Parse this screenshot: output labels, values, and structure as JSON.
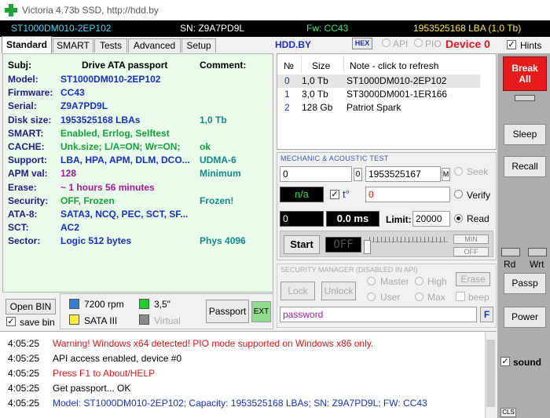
{
  "window": {
    "title": "Victoria 4.73b SSD, http://hdd.by"
  },
  "infobar": {
    "model": "ST1000DM010-2EP102",
    "sn": "SN: Z9A7PD9L",
    "fw": "Fw: CC43",
    "lba": "1953525168 LBA (1,0 Tb)"
  },
  "tabs": [
    "Standard",
    "SMART",
    "Tests",
    "Advanced",
    "Setup"
  ],
  "toolbar": {
    "site": "HDD.BY",
    "hex": "HEX",
    "api": "API",
    "pio": "PIO",
    "device": "Device 0",
    "hints": "Hints"
  },
  "passport": {
    "subj_header": "Subj:",
    "title_header": "Drive ATA passport",
    "comment_header": "Comment:",
    "rows": [
      {
        "label": "Model:",
        "value": "ST1000DM010-2EP102",
        "comment": ""
      },
      {
        "label": "Firmware:",
        "value": "CC43",
        "comment": ""
      },
      {
        "label": "Serial:",
        "value": "Z9A7PD9L",
        "comment": ""
      },
      {
        "label": "Disk size:",
        "value": "1953525168 LBAs",
        "comment": "1,0 Tb"
      },
      {
        "label": "SMART:",
        "value": "Enabled, Errlog, Selftest",
        "comment": ""
      },
      {
        "label": "CACHE:",
        "value": "Unk.size; L/A=ON; Wr=ON;",
        "comment": "ok"
      },
      {
        "label": "Support:",
        "value": "LBA, HPA, APM, DLM, DCO...",
        "comment": "UDMA-6"
      },
      {
        "label": "APM val:",
        "value": "128",
        "comment": "Minimum"
      },
      {
        "label": "Erase:",
        "value": "~ 1 hours 56 minutes",
        "comment": ""
      },
      {
        "label": "Security:",
        "value": "OFF, Frozen",
        "comment": "Frozen!"
      },
      {
        "label": "ATA-8:",
        "value": "SATA3, NCQ, PEC, SCT, SF...",
        "comment": ""
      },
      {
        "label": "SCT:",
        "value": "AC2",
        "comment": ""
      },
      {
        "label": "Sector:",
        "value": "Logic 512 bytes",
        "comment": "Phys 4096"
      }
    ]
  },
  "bottom_controls": {
    "open_bin": "Open BIN",
    "save_bin": "save bin",
    "rpm": "7200 rpm",
    "form_factor": "3,5\"",
    "sata": "SATA III",
    "virtual": "Virtual",
    "passport_btn": "Passport",
    "ext_btn": "EXT",
    "colors": {
      "rpm": "#2f7fd8",
      "form": "#22cc33",
      "sata": "#ffee33",
      "virtual": "#8a8a8a"
    }
  },
  "device_list": {
    "headers": [
      "№",
      "Size",
      "Note - click to refresh"
    ],
    "rows": [
      {
        "num": "0",
        "size": "1,0 Tb",
        "note": "ST1000DM010-2EP102"
      },
      {
        "num": "1",
        "size": "3,0 Tb",
        "note": "ST3000DM001-1ER166"
      },
      {
        "num": "2",
        "size": "128 Gb",
        "note": "Patriot Spark"
      }
    ]
  },
  "mechanic": {
    "title": "MECHANIC  &  ACOUSTIC TEST",
    "start_lba": "0",
    "zero_btn": "0",
    "end_lba": "1953525167",
    "m_btn": "M",
    "seek": "Seek",
    "na": "n/a",
    "temp_label": "t°",
    "verify_value": "0",
    "verify": "Verify",
    "counter": "0",
    "speed": "0.0 ms",
    "limit_label": "Limit:",
    "limit_value": "20000",
    "read": "Read",
    "start_btn": "Start",
    "off_indicator": "OFF",
    "min_btn": "MIN",
    "off_btn": "OFF"
  },
  "security": {
    "title": "SECURITY MANAGER (DISABLED IN API)",
    "lock": "Lock",
    "unlock": "Unlock",
    "master": "Master",
    "high": "High",
    "user": "User",
    "max": "Max",
    "erase": "Erase",
    "beep": "beep",
    "password": "password",
    "f_btn": "F"
  },
  "right_panel": {
    "break_all": [
      "Break",
      "All"
    ],
    "sleep": "Sleep",
    "recall": "Recall",
    "rd": "Rd",
    "wrt": "Wrt",
    "passp": "Passp",
    "power": "Power",
    "sound": "sound",
    "cls": "CLS"
  },
  "log": [
    {
      "time": "4:05:25",
      "text": "Warning! Windows x64 detected! PIO mode supported on Windows x86 only.",
      "color": "#e0141a"
    },
    {
      "time": "4:05:25",
      "text": "API access enabled, device #0",
      "color": "#000000"
    },
    {
      "time": "4:05:25",
      "text": "Press F1 to About/HELP",
      "color": "#e0141a"
    },
    {
      "time": "4:05:25",
      "text": "Get passport... OK",
      "color": "#000000"
    },
    {
      "time": "4:05:25",
      "text": "Model: ST1000DM010-2EP102; Capacity: 1953525168 LBAs; SN: Z9A7PD9L; FW: CC43",
      "color": "#1630c8"
    }
  ]
}
